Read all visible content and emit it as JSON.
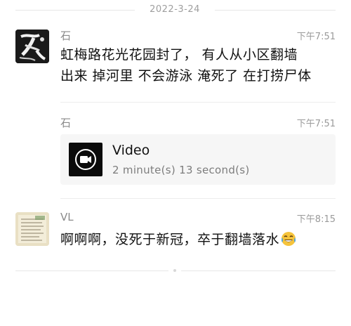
{
  "date_separator": "2022-3-24",
  "messages": [
    {
      "sender": "石",
      "time": "下午7:51",
      "lines": [
        "虹梅路花光花园封了， 有人从小区翻墙",
        "出来 掉河里 不会游泳 淹死了 在打捞尸体"
      ]
    },
    {
      "sender": "石",
      "time": "下午7:51",
      "video": {
        "title": "Video",
        "duration": "2 minute(s) 13 second(s)"
      }
    },
    {
      "sender": "VL",
      "time": "下午8:15",
      "text": "啊啊啊，没死于新冠，卒于翻墙落水",
      "emoji": "crying-laughing-emoji"
    }
  ],
  "colors": {
    "video_thumb": "#0b0b0b",
    "card_bg": "#f6f6f6",
    "emoji_face": "#f5c33b",
    "emoji_tears": "#4aa3df"
  }
}
